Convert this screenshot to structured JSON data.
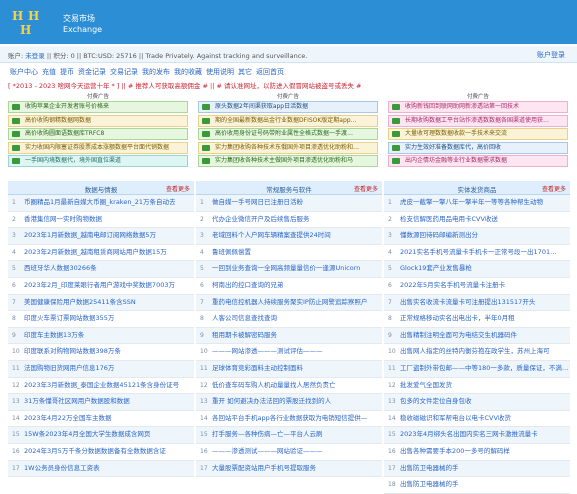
{
  "header": {
    "logo_text": [
      "H",
      "H",
      "H"
    ],
    "site_name_line1": "交易市场",
    "site_name_line2": "Exchange"
  },
  "userbar": {
    "account_label": "账户:",
    "not_logged_in": "未登录",
    "separator1": " || ",
    "info": "积分: 0 || BTC:USD: 25716 || Trade Privately. Against tracking and surveillance.",
    "account_link": "账户登录"
  },
  "nav": {
    "items": [
      "账户中心",
      "充值",
      "提币",
      "资金记录",
      "交易记录",
      "我的发布",
      "我的收藏",
      "使用说明",
      "其它",
      "返回首页"
    ]
  },
  "marquee": "[ *2013 - 2023 啥网今天运营十年 * ] || # 推荐人可获取高额佣金 # || # 请认准网址，以防进入假冒网站被盗号或丢失 #",
  "ads": {
    "head": "付费广告",
    "col1": [
      {
        "text": "收购苹果企业开发者账号价格来",
        "style": "g"
      },
      {
        "text": "高价收购钢精数据网数据",
        "style": "y"
      },
      {
        "text": "高价收购圆面语数据库TRFC8",
        "style": "g"
      },
      {
        "text": "实力收国内限塞证券股票成本涨额数据平台面代销数据",
        "style": "y"
      },
      {
        "text": "一手国内境数据代，境外国直位渠道",
        "style": "t"
      }
    ],
    "col2": [
      {
        "text": "原头数据2年间渠获取app日活数据",
        "style": "b"
      },
      {
        "text": "期的全国最新数据出金行业数据DFISOK版定期app…",
        "style": "y"
      },
      {
        "text": "高价收用身份证号码带附业属性全格式数据一手渡…",
        "style": "g"
      },
      {
        "text": "实力集团收购各种技术东俄国外项目渗透优化助粉和…",
        "style": "y"
      },
      {
        "text": "实力集团收各种技术主做国外项目渗透优化助粉和马",
        "style": "g"
      }
    ],
    "col3": [
      {
        "text": "收购新钱回到联网助网新渗透站第一回技术",
        "style": "p"
      },
      {
        "text": "长期收购数据工平台站作渗透数数据各国渠道使用获…",
        "style": "p"
      },
      {
        "text": "大量收可理数数据收款一手技术来交流",
        "style": "y"
      },
      {
        "text": "实力生效好准备数据库代，高价回收",
        "style": "b"
      },
      {
        "text": "出内企情坊金融等业行业数据需求数据",
        "style": "p"
      }
    ]
  },
  "panels": [
    {
      "title": "数据与情报",
      "more": "查看更多",
      "rows": [
        "币圈精品1月最新自媒大币圈_kraken_21万条自动去",
        "香港集信网一实时购物数据",
        "2023年1月新数据_越南电邮订阅网络数据5万",
        "2023年2月新数据_越南租赁商网站用户数据15万",
        "西班牙华人数据30266条",
        "2023年2月_印度莱眼行者用户游戏中奖数据7003万",
        "美国健康保险用户数据25411条含SSN",
        "印度火车票订票网站数据355万",
        "印度车主数据13万条",
        "印度联系对购物网站数据398万条",
        "法国购物旧货网用户信息176万",
        "2023年3月新数据_泰国企业数据45121条含身份证号",
        "31万条懂哥社区网用户数据股和数据",
        "2023年4月22万全国车主数据",
        "15W条2023年4月全国大学生数据成含网页",
        "2024年3月5万千条分数据数据备有全数数据含证",
        "1W公务员身份信息工资表"
      ]
    },
    {
      "title": "常规服务与软件",
      "more": "查看更多",
      "rows": [
        "做自媒一手号网日已注册日活粉",
        "代办企业微信开户及后续售后服务",
        "老域回料个人户网车辆精案查提供24时间",
        "鲁班佩佩偿置",
        "一回到业务查询一全网高频量量信价一逢源Unicorn",
        "柯南出的控口查询的兄弟",
        "重药电信控机器人持续服务聚实IP防止网警追踪察照户",
        "人客公司信息查找查询",
        "租用期卡被解密码服务",
        "———网站渗透———测试评估———",
        "足球体育竞彩面料主动控制面料",
        "低价查车码车购人机动量量找人居然负责亡",
        "重开 如何避决办法法回的票股迁找到的人",
        "各回站平台手机app各行业数据获取为电销短信提供—",
        "打手服务—各种伤病—亡—平台人云刷",
        "———渗透测试———网站验证———",
        "大量股票配资站用户手机号提取服务"
      ]
    },
    {
      "title": "实体发货商品",
      "more": "查看更多",
      "rows": [
        "虎皮一截擎一擎八年一擎半年一等等各种帮生动物",
        "检支信解医药用品电用卡CVV收送",
        "懂数源回待码邮编新测出分",
        "2021实名手机号流量卡手机卡一正常号段一出1701…",
        "Glock19套产业发售暴枪",
        "2022年5月实名手机号流量卡注册卡",
        "出售实名收流卡流量卡可注册提出131517开头",
        "正常规格移动实名出电出卡，半年0月租",
        "出售精制注明全面可为电结交生机器码件",
        "出售网人指定的丝特内衡芬抱在政学生，苏州上海可",
        "工厂盗制外带包邮——中等180一多款，质量保证，不满…",
        "批发爱气全国发货",
        "包多的文件定位自身包收",
        "稳收磁磁识和军帮电台以电卡CVV收货",
        "2023年4月绑头名出国内实名三网卡激推流量卡",
        "出售各种需要手本200一多号的解码样",
        "出售防卫电器械的手",
        "出售防卫电器械的手"
      ]
    }
  ],
  "colors": {
    "header_bg": "#2c8fd6",
    "logo": "#f6d24a",
    "link": "#2a66c8",
    "more": "#c21d1d"
  }
}
